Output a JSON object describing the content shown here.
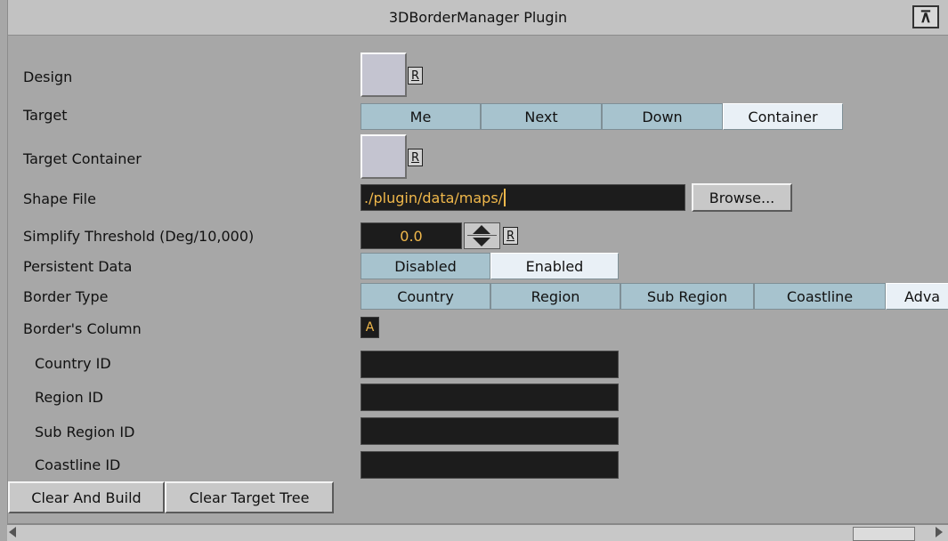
{
  "window": {
    "title": "3DBorderManager Plugin",
    "icon": "viz-plugin-icon"
  },
  "labels": {
    "design": "Design",
    "target": "Target",
    "target_container": "Target Container",
    "shape_file": "Shape File",
    "simplify": "Simplify Threshold (Deg/10,000)",
    "persistent": "Persistent Data",
    "border_type": "Border Type",
    "borders_column": "Border's Column",
    "country_id": "Country ID",
    "region_id": "Region ID",
    "sub_region_id": "Sub Region ID",
    "coastline_id": "Coastline ID"
  },
  "reset_label": "R",
  "target": {
    "options": [
      "Me",
      "Next",
      "Down",
      "Container"
    ],
    "selected": "Container"
  },
  "shape_file": {
    "value": "./plugin/data/maps/",
    "browse_label": "Browse..."
  },
  "simplify": {
    "value": "0.0"
  },
  "persistent": {
    "options": [
      "Disabled",
      "Enabled"
    ],
    "selected": "Enabled"
  },
  "border_type": {
    "options": [
      "Country",
      "Region",
      "Sub Region",
      "Coastline",
      "Adva"
    ],
    "selected": "Adva"
  },
  "borders_column": {
    "button": "A"
  },
  "ids": {
    "country": "",
    "region": "",
    "sub_region": "",
    "coastline": ""
  },
  "actions": {
    "clear_and_build": "Clear And Build",
    "clear_target_tree": "Clear Target Tree"
  },
  "colors": {
    "panel": "#a7a7a7",
    "segment": "#a7c3ce",
    "segment_selected": "#e9f0f6",
    "field_bg": "#1c1c1c",
    "field_text": "#f0b84b"
  }
}
